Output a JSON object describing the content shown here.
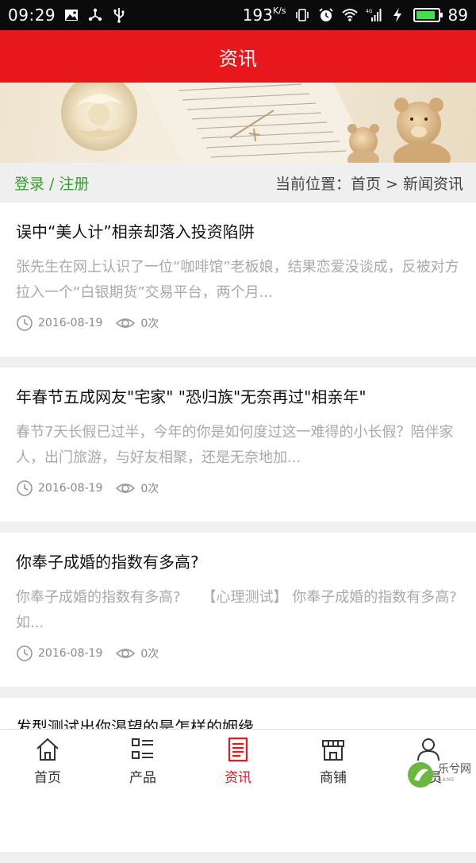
{
  "status_bar": {
    "time": "09:29",
    "speed": "193",
    "speed_unit": "K/s",
    "network": "4G",
    "battery": "89",
    "battery_color": "#3fe04a"
  },
  "header": {
    "title": "资讯",
    "color": "#e8171c"
  },
  "location_bar": {
    "login": "登录",
    "separator": "/",
    "register": "注册",
    "breadcrumb": "当前位置：首页 > 新闻资讯"
  },
  "news": [
    {
      "title": "误中“美人计”相亲却落入投资陷阱",
      "summary": "张先生在网上认识了一位“咖啡馆”老板娘，结果恋爱没谈成，反被对方拉入一个“白银期货”交易平台，两个月...",
      "date": "2016-08-19",
      "views": "0次"
    },
    {
      "title": "年春节五成网友\"宅家\" \"恐归族\"无奈再过\"相亲年\"",
      "summary": "春节7天长假已过半，今年的你是如何度过这一难得的小长假？陪伴家人，出门旅游，与好友相聚，还是无奈地加...",
      "date": "2016-08-19",
      "views": "0次"
    },
    {
      "title": "你奉子成婚的指数有多高?",
      "summary": "你奉子成婚的指数有多高?　　【心理测试】 你奉子成婚的指数有多高? 如...",
      "date": "2016-08-19",
      "views": "0次"
    },
    {
      "title": "发型测试出你渴望的是怎样的姻缘",
      "summary": "",
      "date": "",
      "views": ""
    }
  ],
  "bottom_nav": [
    {
      "label": "首页",
      "icon": "home-icon",
      "active": false
    },
    {
      "label": "产品",
      "icon": "list-icon",
      "active": false
    },
    {
      "label": "资讯",
      "icon": "document-icon",
      "active": true
    },
    {
      "label": "商铺",
      "icon": "store-icon",
      "active": false
    },
    {
      "label": "会员",
      "icon": "user-icon",
      "active": false
    }
  ],
  "watermark": {
    "text": "乐兮网",
    "sub": "GAME"
  }
}
